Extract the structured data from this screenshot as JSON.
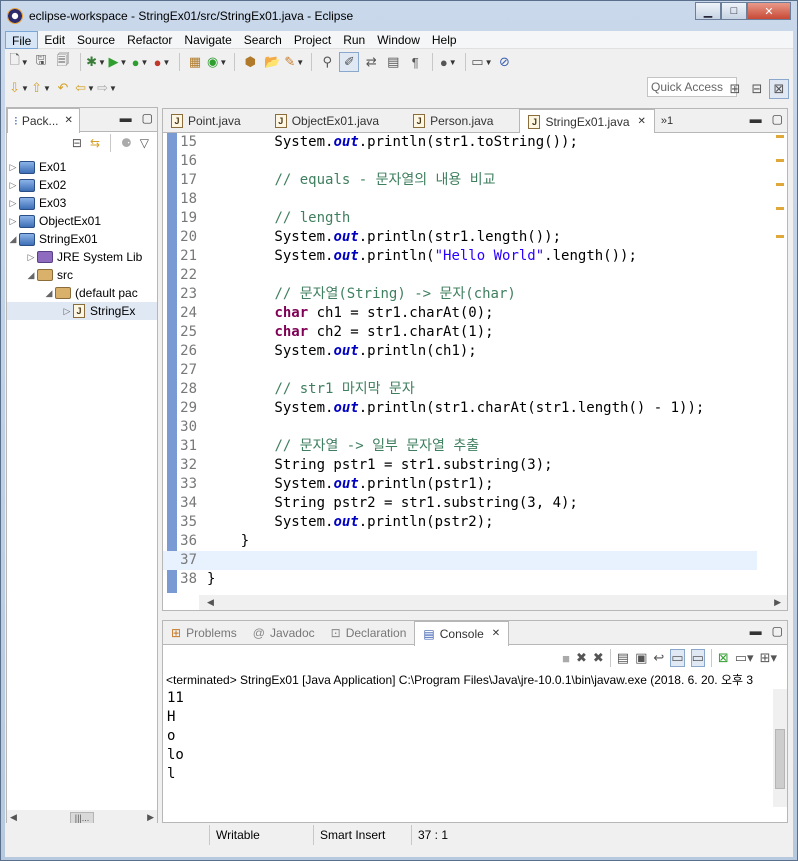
{
  "window": {
    "title": "eclipse-workspace - StringEx01/src/StringEx01.java - Eclipse"
  },
  "menus": [
    "File",
    "Edit",
    "Source",
    "Refactor",
    "Navigate",
    "Search",
    "Project",
    "Run",
    "Window",
    "Help"
  ],
  "quick_access": "Quick Access",
  "package_explorer": {
    "tab_label": "Pack...",
    "items": [
      {
        "label": "Ex01"
      },
      {
        "label": "Ex02"
      },
      {
        "label": "Ex03"
      },
      {
        "label": "ObjectEx01"
      },
      {
        "label": "StringEx01"
      },
      {
        "label": "JRE System Lib"
      },
      {
        "label": "src"
      },
      {
        "label": "(default pac"
      },
      {
        "label": "StringEx"
      }
    ],
    "hscroll_left": "◀",
    "hscroll_thumb": "|||...",
    "hscroll_right": "▶"
  },
  "editor": {
    "tabs": [
      "Point.java",
      "ObjectEx01.java",
      "Person.java",
      "StringEx01.java"
    ],
    "overflow_count": "»1",
    "lines": [
      {
        "n": "15",
        "code": "        System.out.println(str1.toString());"
      },
      {
        "n": "16",
        "code": ""
      },
      {
        "n": "17",
        "code": "        // equals - 문자열의 내용 비교"
      },
      {
        "n": "18",
        "code": ""
      },
      {
        "n": "19",
        "code": "        // length"
      },
      {
        "n": "20",
        "code": "        System.out.println(str1.length());"
      },
      {
        "n": "21",
        "code": "        System.out.println(\"Hello World\".length());"
      },
      {
        "n": "22",
        "code": ""
      },
      {
        "n": "23",
        "code": "        // 문자열(String) -> 문자(char)"
      },
      {
        "n": "24",
        "code": "        char ch1 = str1.charAt(0);"
      },
      {
        "n": "25",
        "code": "        char ch2 = str1.charAt(1);"
      },
      {
        "n": "26",
        "code": "        System.out.println(ch1);"
      },
      {
        "n": "27",
        "code": ""
      },
      {
        "n": "28",
        "code": "        // str1 마지막 문자"
      },
      {
        "n": "29",
        "code": "        System.out.println(str1.charAt(str1.length() - 1));"
      },
      {
        "n": "30",
        "code": ""
      },
      {
        "n": "31",
        "code": "        // 문자열 -> 일부 문자열 추출"
      },
      {
        "n": "32",
        "code": "        String pstr1 = str1.substring(3);"
      },
      {
        "n": "33",
        "code": "        System.out.println(pstr1);"
      },
      {
        "n": "34",
        "code": "        String pstr2 = str1.substring(3, 4);"
      },
      {
        "n": "35",
        "code": "        System.out.println(pstr2);"
      },
      {
        "n": "36",
        "code": "    }"
      },
      {
        "n": "37",
        "code": ""
      },
      {
        "n": "38",
        "code": "}"
      }
    ]
  },
  "bottom_tabs": [
    "Problems",
    "Javadoc",
    "Declaration",
    "Console"
  ],
  "console": {
    "status": "<terminated> StringEx01 [Java Application] C:\\Program Files\\Java\\jre-10.0.1\\bin\\javaw.exe (2018. 6. 20. 오후 3",
    "output": [
      "11",
      "H",
      "o",
      "lo",
      "l"
    ]
  },
  "statusbar": {
    "writable": "Writable",
    "insert_mode": "Smart Insert",
    "position": "37 : 1"
  }
}
